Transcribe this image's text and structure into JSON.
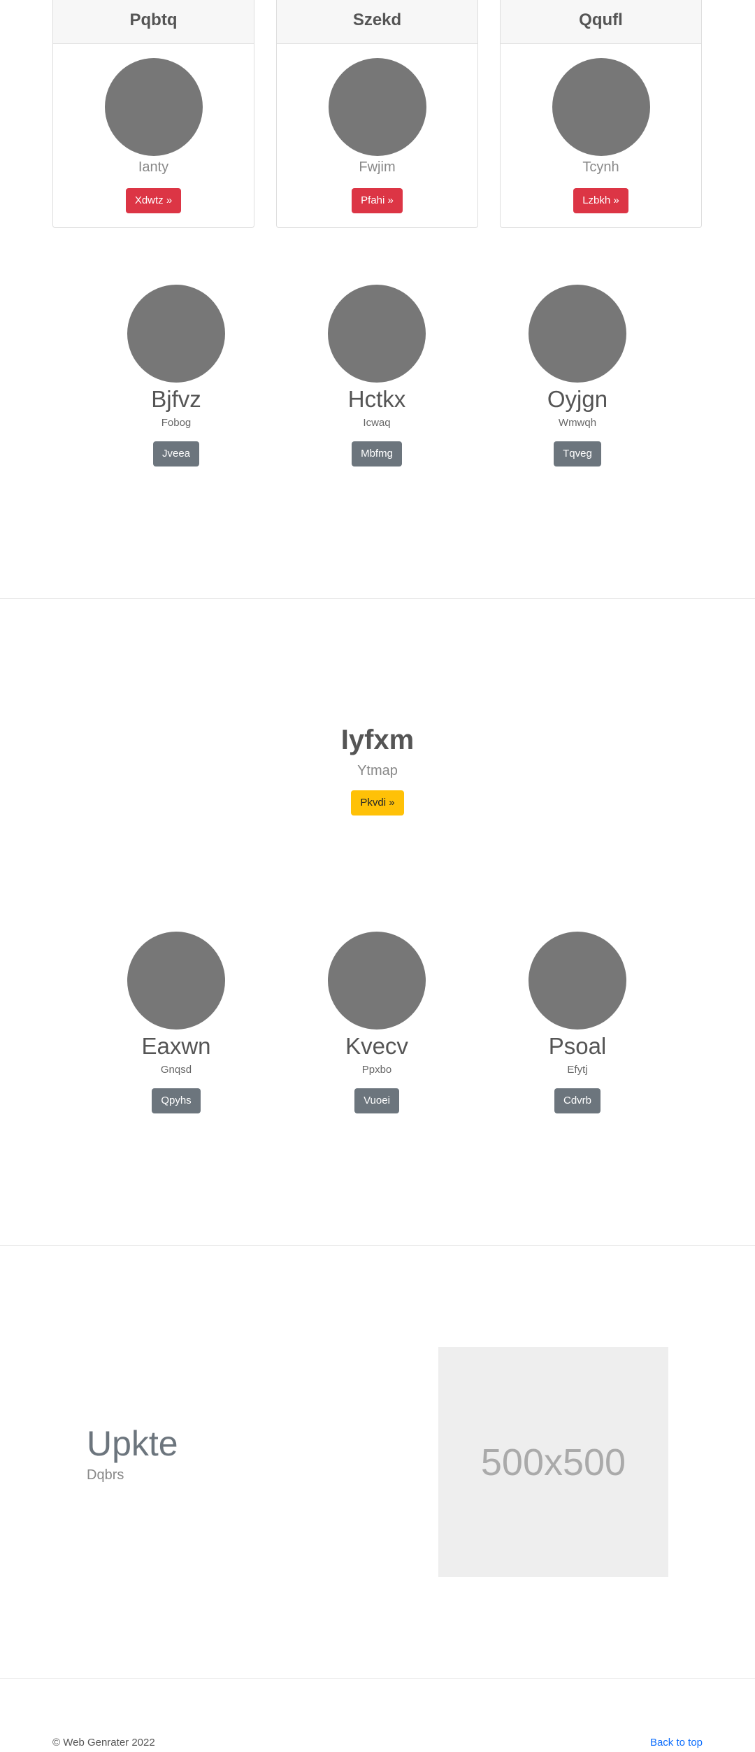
{
  "cards": [
    {
      "header": "Pqbtq",
      "subtitle": "Ianty",
      "button": "Xdwtz »"
    },
    {
      "header": "Szekd",
      "subtitle": "Fwjim",
      "button": "Pfahi »"
    },
    {
      "header": "Qqufl",
      "subtitle": "Tcynh",
      "button": "Lzbkh »"
    }
  ],
  "circles_row1": [
    {
      "title": "Bjfvz",
      "subtitle": "Fobog",
      "button": "Jveea"
    },
    {
      "title": "Hctkx",
      "subtitle": "Icwaq",
      "button": "Mbfmg"
    },
    {
      "title": "Oyjgn",
      "subtitle": "Wmwqh",
      "button": "Tqveg"
    }
  ],
  "hero": {
    "title": "Iyfxm",
    "subtitle": "Ytmap",
    "button": "Pkvdi »"
  },
  "circles_row2": [
    {
      "title": "Eaxwn",
      "subtitle": "Gnqsd",
      "button": "Qpyhs"
    },
    {
      "title": "Kvecv",
      "subtitle": "Ppxbo",
      "button": "Vuoei"
    },
    {
      "title": "Psoal",
      "subtitle": "Efytj",
      "button": "Cdvrb"
    }
  ],
  "feature": {
    "title": "Upkte",
    "subtitle": "Dqbrs",
    "placeholder": "500x500"
  },
  "footer": {
    "copyright": "© Web Genrater 2022",
    "back_to_top": "Back to top"
  }
}
